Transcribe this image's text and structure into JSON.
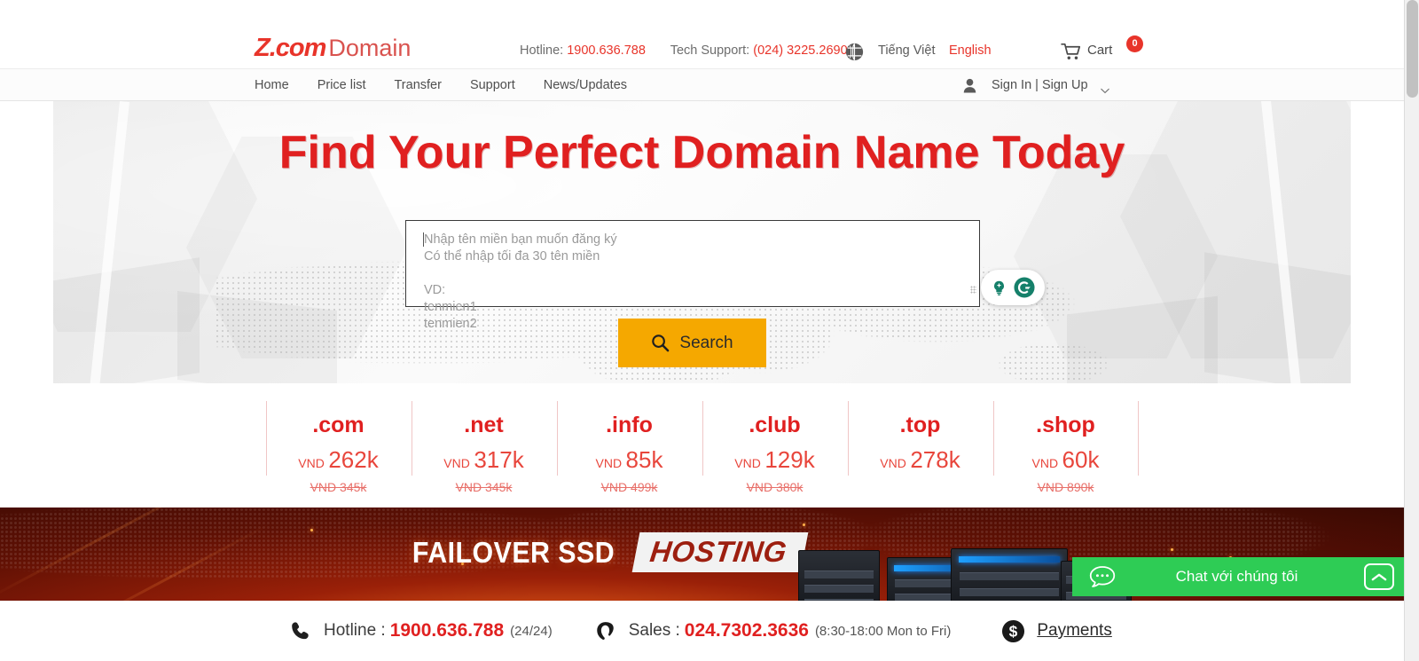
{
  "header": {
    "logo_z": "Z.com",
    "logo_domain": "Domain",
    "hotline_label": "Hotline:",
    "hotline_number": "1900.636.788",
    "tech_support_label": "Tech Support:",
    "tech_support_number": "(024) 3225.2690",
    "globe_icon": "globe-icon",
    "lang_vietnamese": "Tiếng Việt",
    "lang_english": "English",
    "cart_icon": "cart-icon",
    "cart_label": "Cart",
    "cart_count": "0"
  },
  "nav": {
    "items": [
      {
        "label": "Home"
      },
      {
        "label": "Price list"
      },
      {
        "label": "Transfer"
      },
      {
        "label": "Support"
      },
      {
        "label": "News/Updates"
      }
    ],
    "user_icon": "user-icon",
    "account_label": "Sign In | Sign Up",
    "caret_icon": "chevron-down-icon"
  },
  "hero": {
    "title": "Find Your Perfect Domain Name Today",
    "search_placeholder": "Nhập tên miền bạn muốn đăng ký\nCó thể nhập tối đa 30 tên miền\n\nVD:\ntenmien1\ntenmien2",
    "search_value": "",
    "search_button_label": "Search",
    "search_icon": "magnifier-icon",
    "grammarly_lightbulb_icon": "lightbulb-icon",
    "grammarly_logo_icon": "grammarly-g-icon"
  },
  "tlds": [
    {
      "name": ".com",
      "currency": "VND",
      "price": "262k",
      "old_price": "VND 345k"
    },
    {
      "name": ".net",
      "currency": "VND",
      "price": "317k",
      "old_price": "VND 345k"
    },
    {
      "name": ".info",
      "currency": "VND",
      "price": "85k",
      "old_price": "VND 499k"
    },
    {
      "name": ".club",
      "currency": "VND",
      "price": "129k",
      "old_price": "VND 380k"
    },
    {
      "name": ".top",
      "currency": "VND",
      "price": "278k",
      "old_price": ""
    },
    {
      "name": ".shop",
      "currency": "VND",
      "price": "60k",
      "old_price": "VND 890k"
    }
  ],
  "hosting_banner": {
    "text_primary": "FAILOVER SSD",
    "text_highlight": "HOSTING"
  },
  "chat": {
    "label": "Chat với chúng tôi",
    "bubble_icon": "chat-bubble-icon",
    "expand_icon": "chevron-up-icon"
  },
  "footer": {
    "phone_icon": "phone-icon",
    "hotline_label": "Hotline :",
    "hotline_number": "1900.636.788",
    "hotline_hours": "(24/24)",
    "headset_icon": "headset-icon",
    "sales_label": "Sales :",
    "sales_number": "024.7302.3636",
    "sales_hours": "(8:30-18:00 Mon to Fri)",
    "payments_icon": "dollar-circle-icon",
    "payments_label": "Payments"
  },
  "colors": {
    "brand_red": "#e02020",
    "accent_orange": "#f5a800",
    "chat_green": "#2ecc55",
    "grammarly_green": "#15806a"
  }
}
